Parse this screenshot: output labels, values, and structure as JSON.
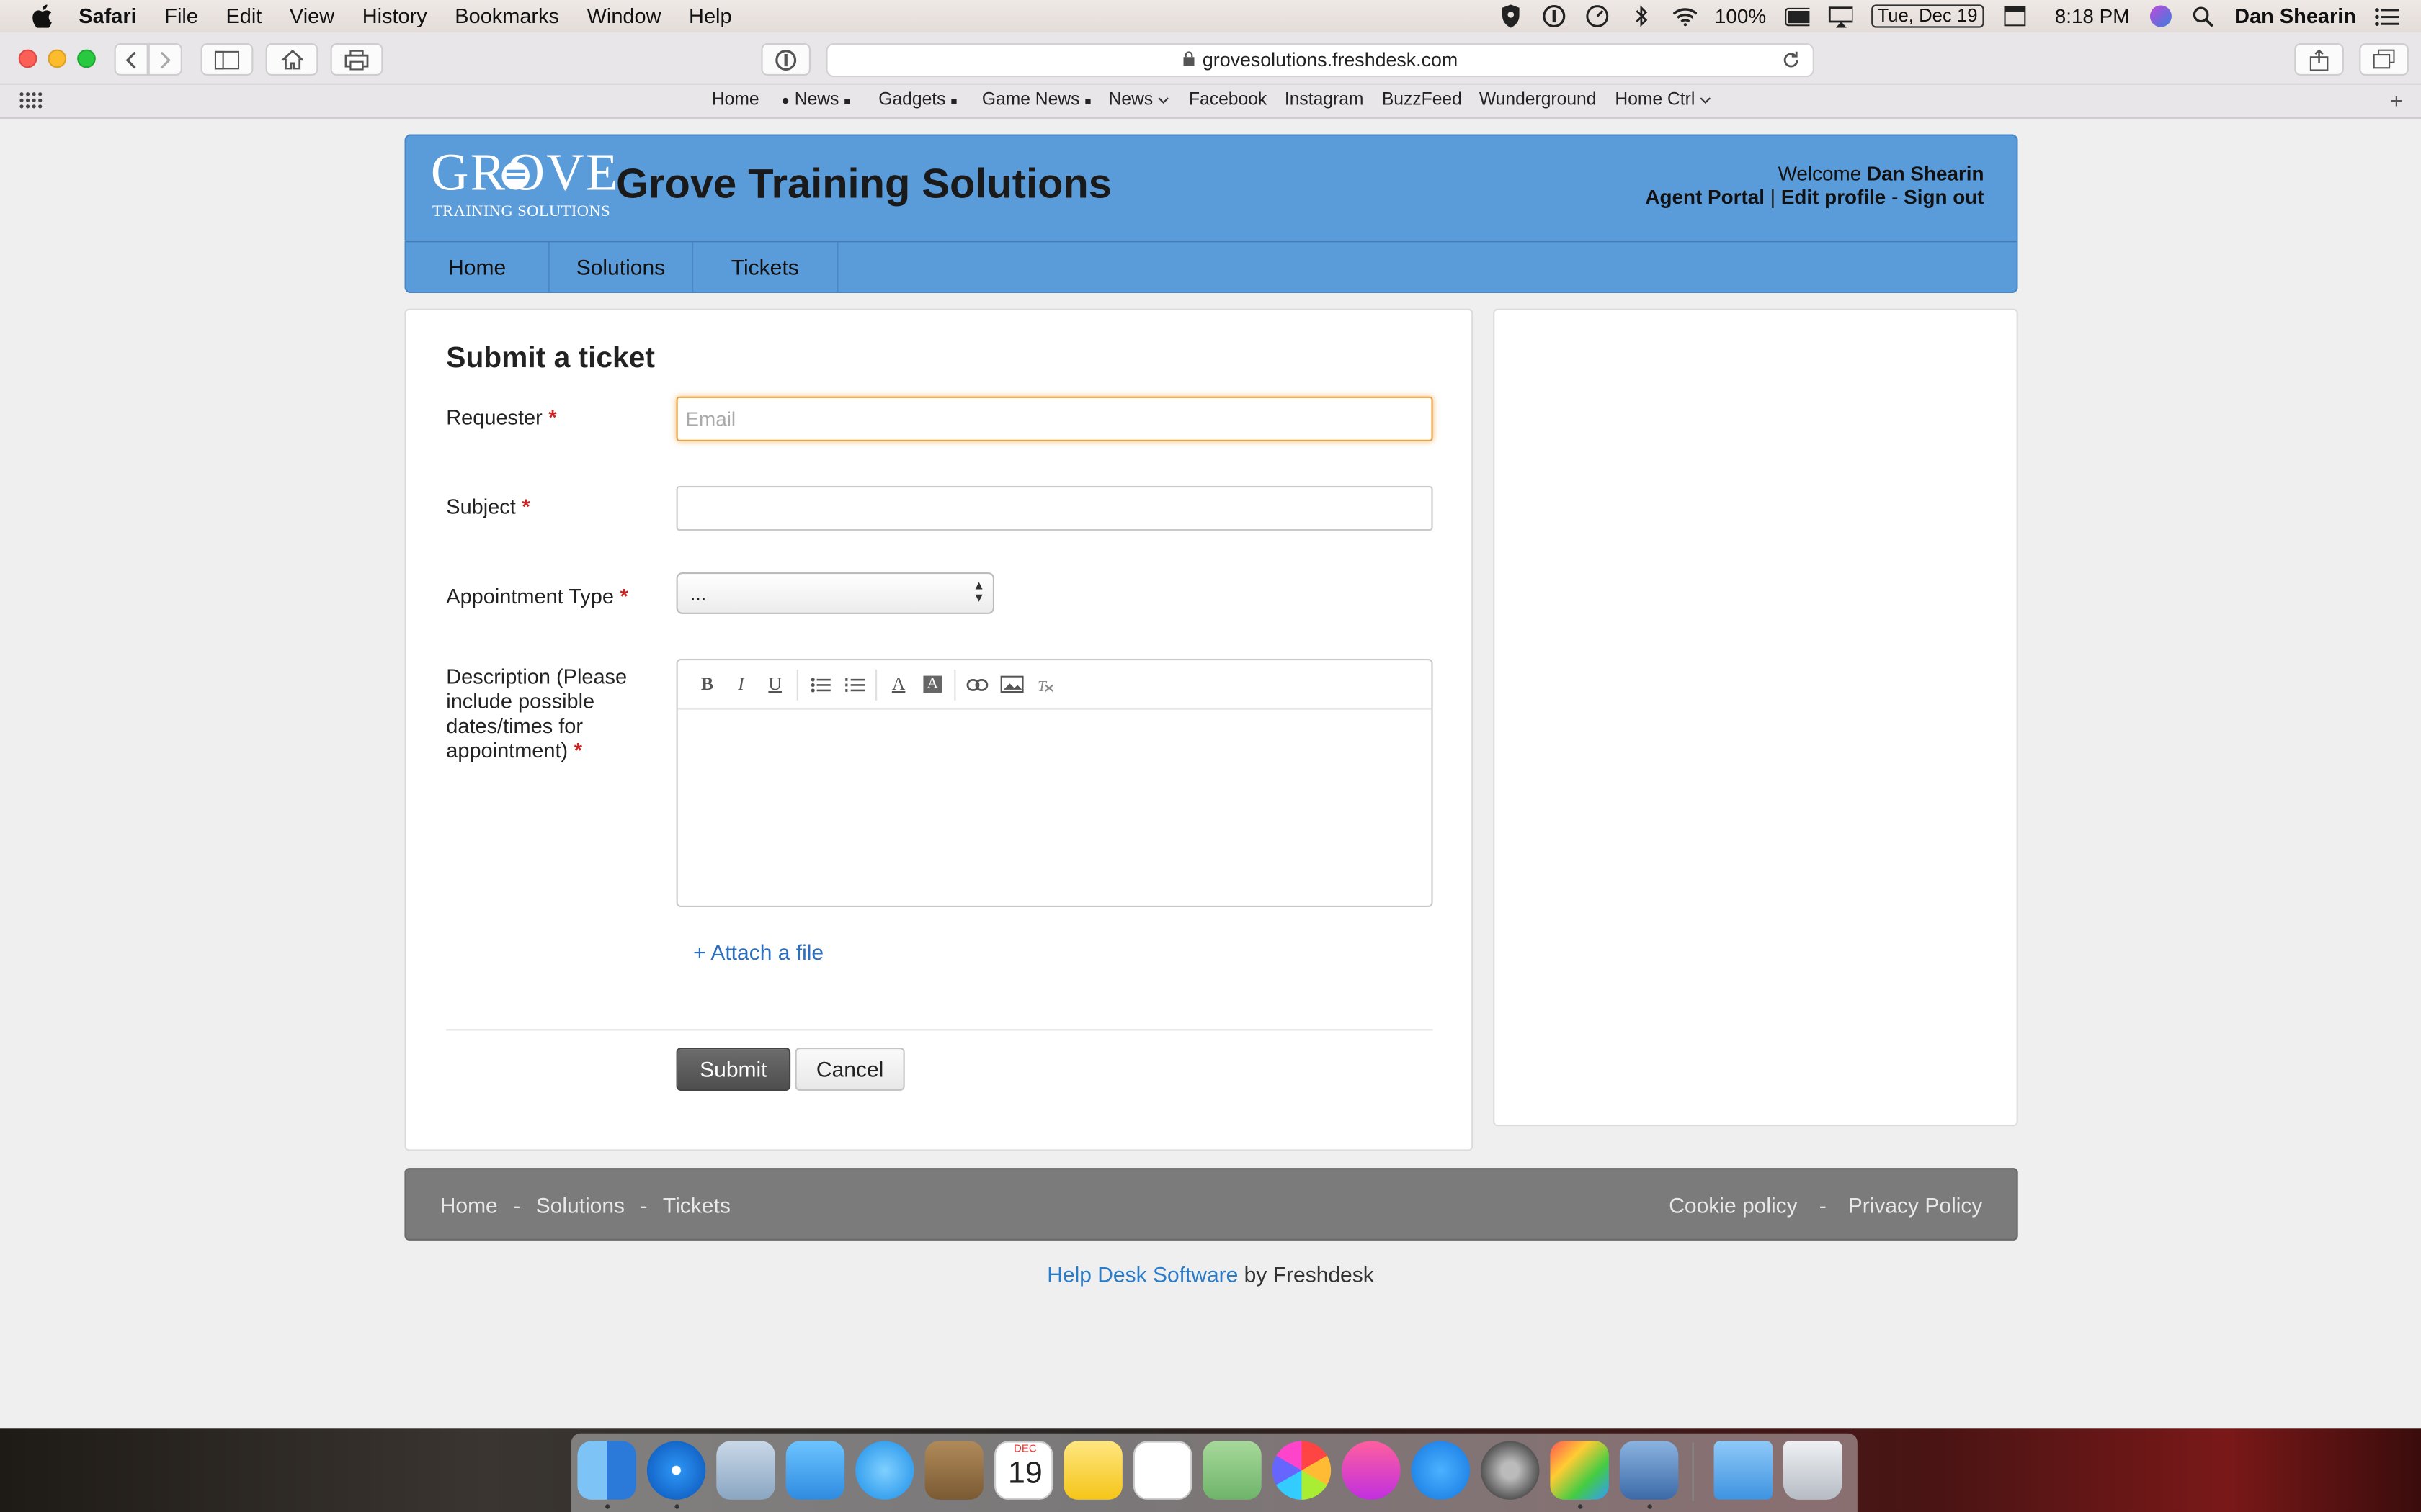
{
  "menubar": {
    "app": "Safari",
    "items": [
      "File",
      "Edit",
      "View",
      "History",
      "Bookmarks",
      "Window",
      "Help"
    ],
    "battery": "100%",
    "date": "Tue, Dec 19",
    "time": "8:18 PM",
    "user": "Dan Shearin"
  },
  "browser": {
    "url": "grovesolutions.freshdesk.com",
    "bookmarks": [
      "Home",
      "News",
      "Gadgets",
      "Game News",
      "News",
      "Facebook",
      "Instagram",
      "BuzzFeed",
      "Wunderground",
      "Home Ctrl"
    ]
  },
  "header": {
    "logo_word": "GROVE",
    "logo_sub": "TRAINING SOLUTIONS",
    "title": "Grove Training Solutions",
    "welcome_prefix": "Welcome",
    "user_name": "Dan Shearin",
    "agent_portal": "Agent Portal",
    "separator": "|",
    "edit_profile": "Edit profile",
    "dash": "-",
    "sign_out": "Sign out"
  },
  "nav": {
    "tabs": [
      "Home",
      "Solutions",
      "Tickets"
    ]
  },
  "form": {
    "title": "Submit a ticket",
    "requester_label": "Requester",
    "requester_placeholder": "Email",
    "requester_value": "",
    "subject_label": "Subject",
    "subject_value": "",
    "appointment_label": "Appointment Type",
    "appointment_selected": "...",
    "description_label": "Description (Please include possible dates/times for appointment)",
    "required_mark": "*",
    "toolbar": [
      "bold",
      "italic",
      "underline",
      "bullet-list",
      "numbered-list",
      "font-color",
      "background-color",
      "link",
      "image",
      "remove-format"
    ],
    "attach_label": "+ Attach a file",
    "submit_label": "Submit",
    "cancel_label": "Cancel"
  },
  "footer": {
    "left_links": [
      "Home",
      "Solutions",
      "Tickets"
    ],
    "sep": "-",
    "right_links": [
      "Cookie policy",
      "Privacy Policy"
    ],
    "powered_link": "Help Desk Software",
    "powered_suffix": " by Freshdesk"
  },
  "dock": {
    "calendar_month": "DEC",
    "calendar_day": "19"
  },
  "colors": {
    "header_blue": "#5a9bd9",
    "focus_orange": "#e9a243",
    "required_red": "#cc2222",
    "link_blue": "#2a6fc0",
    "footer_gray": "#7b7b7b"
  }
}
